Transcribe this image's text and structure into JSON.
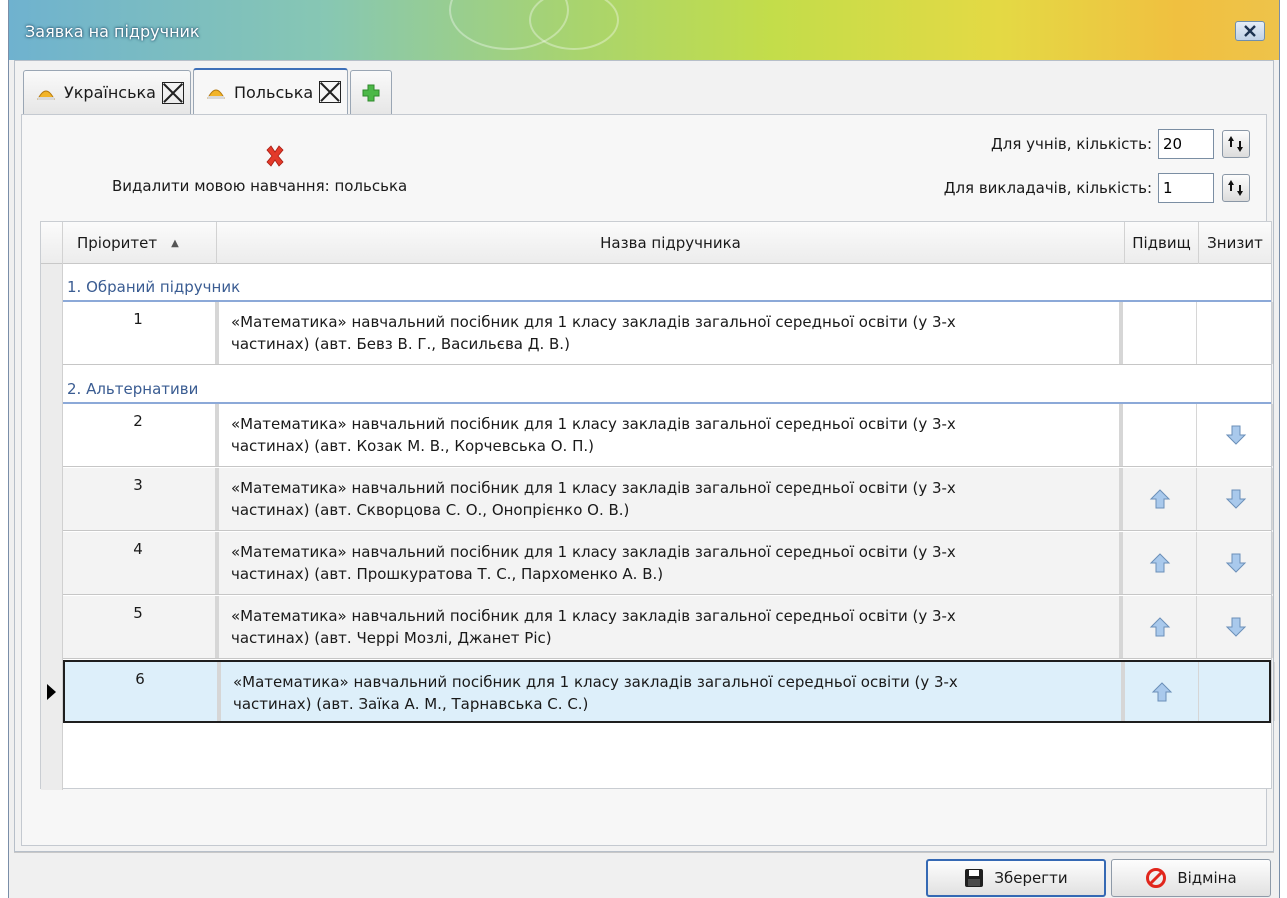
{
  "window": {
    "title": "Заявка на підручник"
  },
  "tabs": [
    {
      "label": "Українська",
      "active": false
    },
    {
      "label": "Польська",
      "active": true
    }
  ],
  "toolbar": {
    "delete_language_label": "Видалити мовою навчання: польська"
  },
  "quantities": {
    "students_label": "Для учнів, кількість:",
    "students_value": "20",
    "teachers_label": "Для викладачів, кількість:",
    "teachers_value": "1"
  },
  "grid": {
    "columns": [
      "Пріоритет",
      "Назва підручника",
      "Підвищ",
      "Знизит"
    ],
    "groups": [
      {
        "title": "1. Обраний підручник",
        "rows": [
          {
            "priority": "1",
            "line1": "«Математика» навчальний посібник для 1 класу закладів загальної середньої освіти (у 3-х",
            "line2": "частинах)  (авт. Бевз В. Г., Васильєва Д. В.)",
            "up": false,
            "down": false
          }
        ]
      },
      {
        "title": "2. Альтернативи",
        "rows": [
          {
            "priority": "2",
            "line1": "«Математика» навчальний посібник для 1 класу закладів загальної середньої освіти (у 3-х",
            "line2": "частинах)  (авт. Козак М. В., Корчевська О. П.)",
            "up": false,
            "down": true
          },
          {
            "priority": "3",
            "line1": "«Математика» навчальний посібник для 1 класу закладів загальної середньої освіти (у 3-х",
            "line2": "частинах)  (авт. Скворцова С. О., Онопрієнко О. В.)",
            "up": true,
            "down": true
          },
          {
            "priority": "4",
            "line1": "«Математика» навчальний посібник для 1 класу закладів загальної середньої освіти (у 3-х",
            "line2": "частинах)  (авт. Прошкуратова Т. С., Пархоменко А. В.)",
            "up": true,
            "down": true
          },
          {
            "priority": "5",
            "line1": "«Математика» навчальний посібник для 1 класу закладів загальної середньої освіти (у 3-х",
            "line2": "частинах)  (авт. Черрі Мозлі, Джанет Ріс)",
            "up": true,
            "down": true
          },
          {
            "priority": "6",
            "line1": "«Математика» навчальний посібник для 1 класу закладів загальної середньої освіти (у 3-х",
            "line2": "частинах)  (авт. Заїка А. М., Тарнавська С. С.)",
            "up": true,
            "down": false,
            "selected": true
          }
        ]
      }
    ]
  },
  "buttons": {
    "save": "Зберегти",
    "cancel": "Відміна"
  },
  "colors": {
    "accent": "#3569b4",
    "group_text": "#3a5c92",
    "selected_row": "#ddeffa",
    "arrow_fill": "#a9c9ec"
  }
}
